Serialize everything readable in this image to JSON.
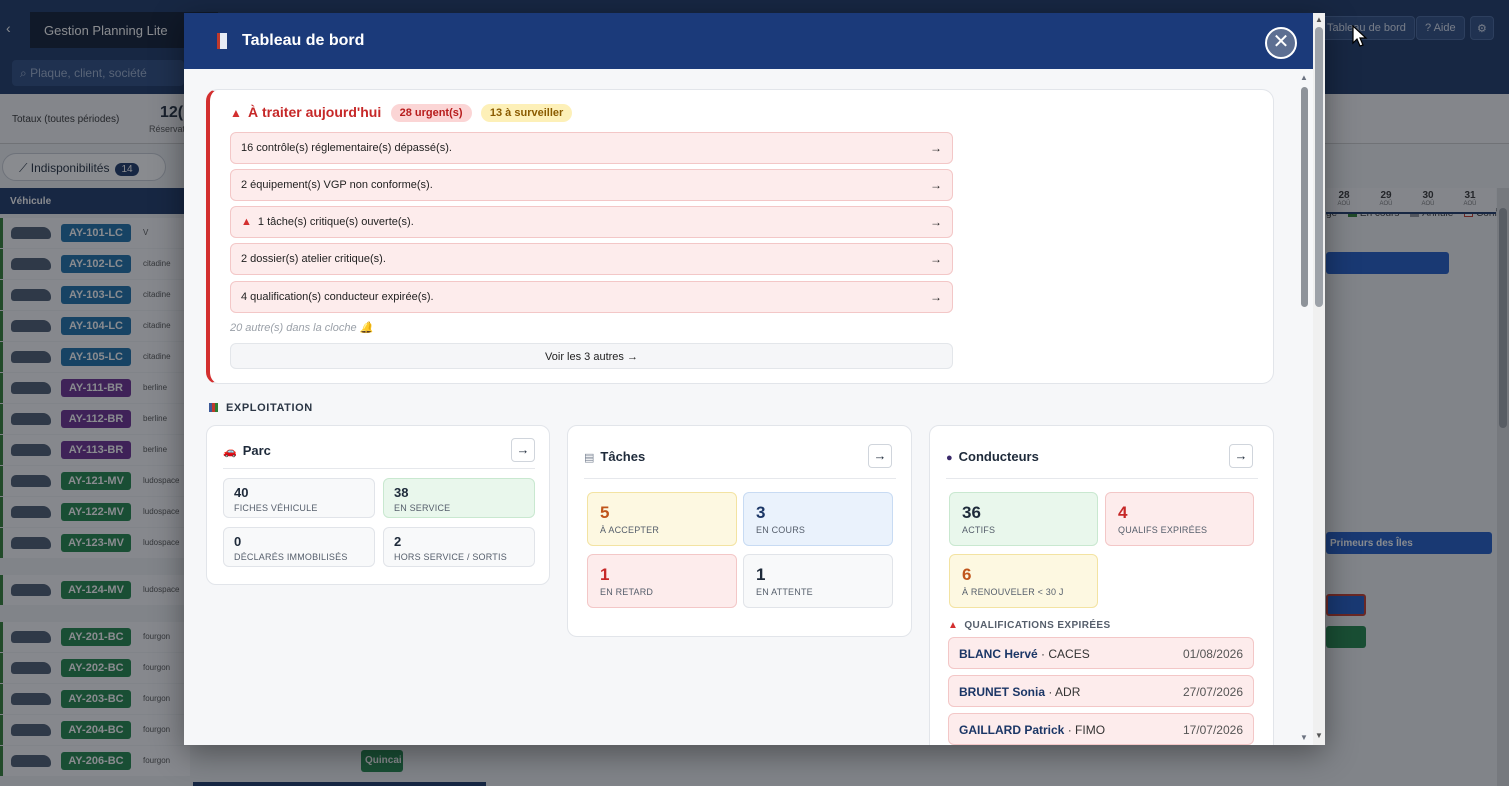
{
  "background": {
    "app_title": "Gestion Planning Lite",
    "back_glyph": "‹",
    "search_placeholder": "Plaque, client, société",
    "buttons": {
      "dashboard": "Tableau de bord",
      "help": "? Aide",
      "gear": "⚙"
    },
    "totals": {
      "label": "Totaux (toutes périodes)",
      "number": "12(",
      "sub": "Réservat"
    },
    "legend": [
      {
        "color": "#2e7d32",
        "label": "En cours"
      },
      {
        "color": "#8e939a",
        "label": "Annulé"
      },
      {
        "color": "#ffffff",
        "label": "Conflit"
      }
    ],
    "legend_prefix": "ge",
    "indispo": {
      "label": "Indisponibilités",
      "count": "14"
    },
    "vehicle_header": "Véhicule",
    "dates": [
      {
        "d": "28",
        "m": "AOÛ"
      },
      {
        "d": "29",
        "m": "AOÛ"
      },
      {
        "d": "30",
        "m": "AOÛ"
      },
      {
        "d": "31",
        "m": "AOÛ"
      }
    ],
    "vehicles": [
      {
        "plate": "AY-101-LC",
        "cat": "V",
        "color": "#1b6fa8"
      },
      {
        "plate": "AY-102-LC",
        "cat": "citadine",
        "color": "#1b6fa8"
      },
      {
        "plate": "AY-103-LC",
        "cat": "citadine",
        "color": "#1b6fa8"
      },
      {
        "plate": "AY-104-LC",
        "cat": "citadine",
        "color": "#1b6fa8"
      },
      {
        "plate": "AY-105-LC",
        "cat": "citadine",
        "color": "#1b6fa8"
      },
      {
        "plate": "AY-111-BR",
        "cat": "berline",
        "color": "#6a2c91"
      },
      {
        "plate": "AY-112-BR",
        "cat": "berline",
        "color": "#6a2c91"
      },
      {
        "plate": "AY-113-BR",
        "cat": "berline",
        "color": "#6a2c91"
      },
      {
        "plate": "AY-121-MV",
        "cat": "ludospace",
        "color": "#1e8449"
      },
      {
        "plate": "AY-122-MV",
        "cat": "ludospace",
        "color": "#1e8449"
      },
      {
        "plate": "AY-123-MV",
        "cat": "ludospace",
        "color": "#1e8449"
      },
      {
        "plate": "AY-124-MV",
        "cat": "ludospace",
        "color": "#1e8449"
      },
      {
        "plate": "AY-201-BC",
        "cat": "fourgon",
        "color": "#1e8449"
      },
      {
        "plate": "AY-202-BC",
        "cat": "fourgon",
        "color": "#1e8449"
      },
      {
        "plate": "AY-203-BC",
        "cat": "fourgon",
        "color": "#1e8449"
      },
      {
        "plate": "AY-204-BC",
        "cat": "fourgon",
        "color": "#1e8449"
      },
      {
        "plate": "AY-206-BC",
        "cat": "fourgon",
        "color": "#1e8449"
      }
    ],
    "right_bar_label": "Primeurs des Îles",
    "bottom_chip": "Quincai"
  },
  "modal": {
    "title": "Tableau de bord",
    "close_glyph": "✕",
    "alerts": {
      "title": "À traiter aujourd'hui",
      "urgent_pill": "28 urgent(s)",
      "watch_pill": "13 à surveiller",
      "items": [
        {
          "text": "16 contrôle(s) réglementaire(s) dépassé(s).",
          "fire": false
        },
        {
          "text": "2 équipement(s) VGP non conforme(s).",
          "fire": false
        },
        {
          "text": "1 tâche(s) critique(s) ouverte(s).",
          "fire": true
        },
        {
          "text": "2 dossier(s) atelier critique(s).",
          "fire": false
        },
        {
          "text": "4 qualification(s) conducteur expirée(s).",
          "fire": false
        }
      ],
      "more": "20 autre(s) dans la cloche 🔔",
      "voir": "Voir les 3 autres →",
      "arrow": "→"
    },
    "section_title": "EXPLOITATION",
    "parc": {
      "title": "Parc",
      "arrow": "→",
      "stats": [
        {
          "num": "40",
          "label": "FICHES VÉHICULE"
        },
        {
          "num": "38",
          "label": "EN SERVICE"
        },
        {
          "num": "0",
          "label": "DÉCLARÉS IMMOBILISÉS"
        },
        {
          "num": "2",
          "label": "HORS SERVICE / SORTIS"
        }
      ]
    },
    "taches": {
      "title": "Tâches",
      "arrow": "→",
      "stats": [
        {
          "num": "5",
          "label": "À ACCEPTER"
        },
        {
          "num": "3",
          "label": "EN COURS"
        },
        {
          "num": "1",
          "label": "EN RETARD"
        },
        {
          "num": "1",
          "label": "EN ATTENTE"
        }
      ]
    },
    "conducteurs": {
      "title": "Conducteurs",
      "arrow": "→",
      "stats": [
        {
          "num": "36",
          "label": "ACTIFS"
        },
        {
          "num": "4",
          "label": "QUALIFS EXPIRÉES"
        },
        {
          "num": "6",
          "label": "À RENOUVELER < 30 J"
        }
      ],
      "qual_title": "QUALIFICATIONS EXPIRÉES",
      "quals": [
        {
          "name": "BLANC Hervé",
          "type": "· CACES",
          "date": "01/08/2026"
        },
        {
          "name": "BRUNET Sonia",
          "type": "· ADR",
          "date": "27/07/2026"
        },
        {
          "name": "GAILLARD Patrick",
          "type": "· FIMO",
          "date": "17/07/2026"
        }
      ]
    }
  }
}
